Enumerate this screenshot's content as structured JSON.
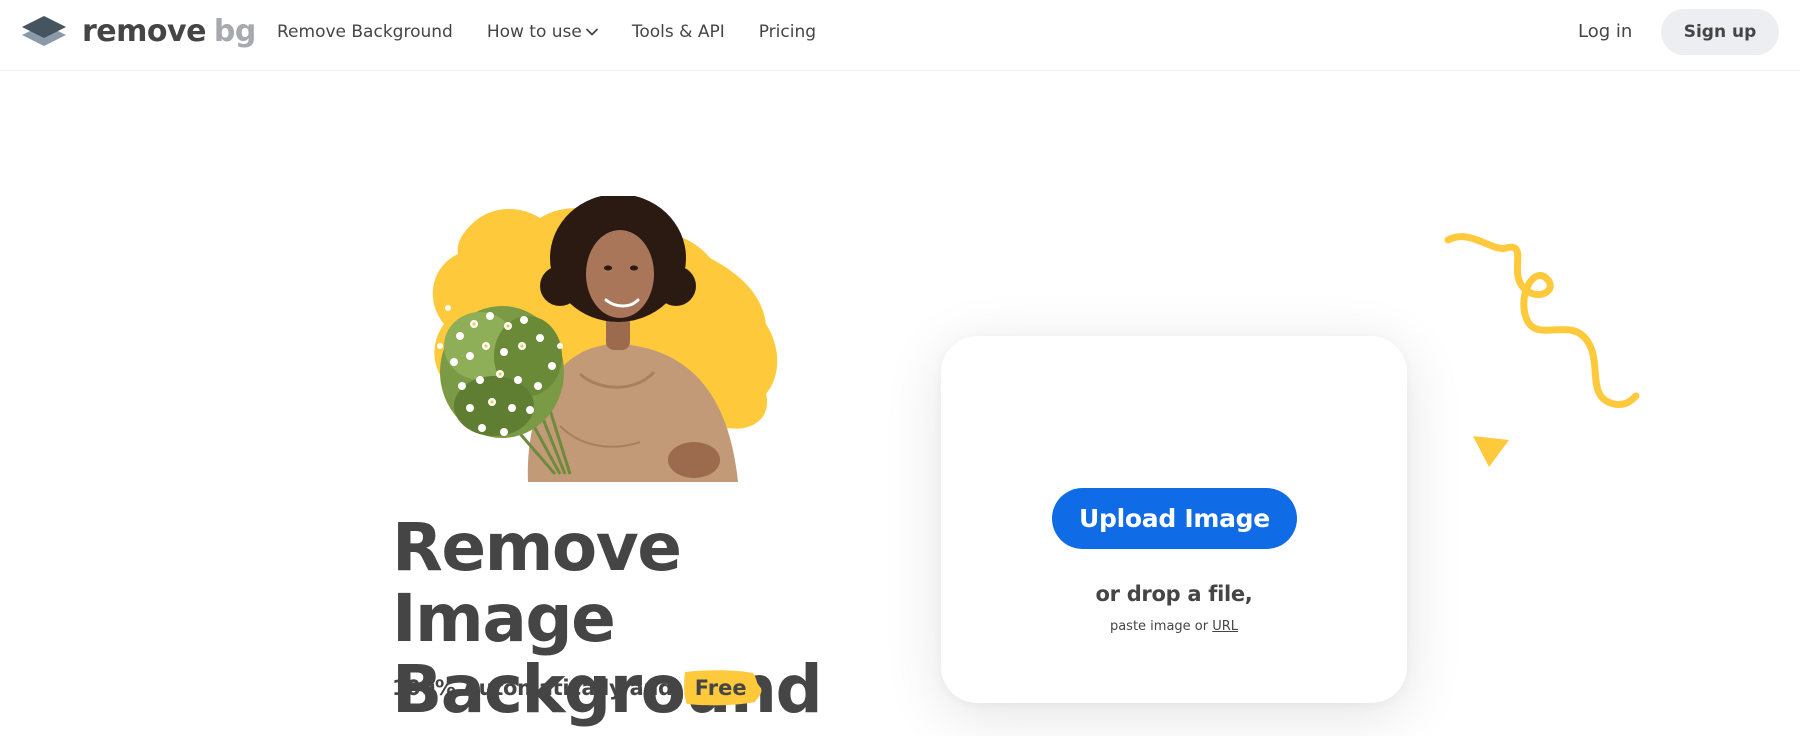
{
  "header": {
    "logo": {
      "word1": "remove",
      "word2": "bg"
    },
    "nav": [
      {
        "label": "Remove Background"
      },
      {
        "label": "How to use",
        "has_dropdown": true
      },
      {
        "label": "Tools & API"
      },
      {
        "label": "Pricing"
      }
    ],
    "login_label": "Log in",
    "signup_label": "Sign up"
  },
  "hero": {
    "headline_line1": "Remove Image",
    "headline_line2": "Background",
    "subline": "100% Automatically and",
    "badge": "Free"
  },
  "upload": {
    "button_label": "Upload Image",
    "drop_text": "or drop a file,",
    "paste_prefix": "paste image or",
    "url_label": "URL"
  },
  "colors": {
    "accent_blue": "#0f6be6",
    "accent_yellow": "#ffc93c",
    "text_dark": "#454545",
    "signup_bg": "#eceef1"
  },
  "icons": {
    "logo": "layers-logo-icon",
    "dropdown": "chevron-down-icon",
    "decor1": "squiggle-decoration",
    "decor2": "triangle-decoration"
  }
}
